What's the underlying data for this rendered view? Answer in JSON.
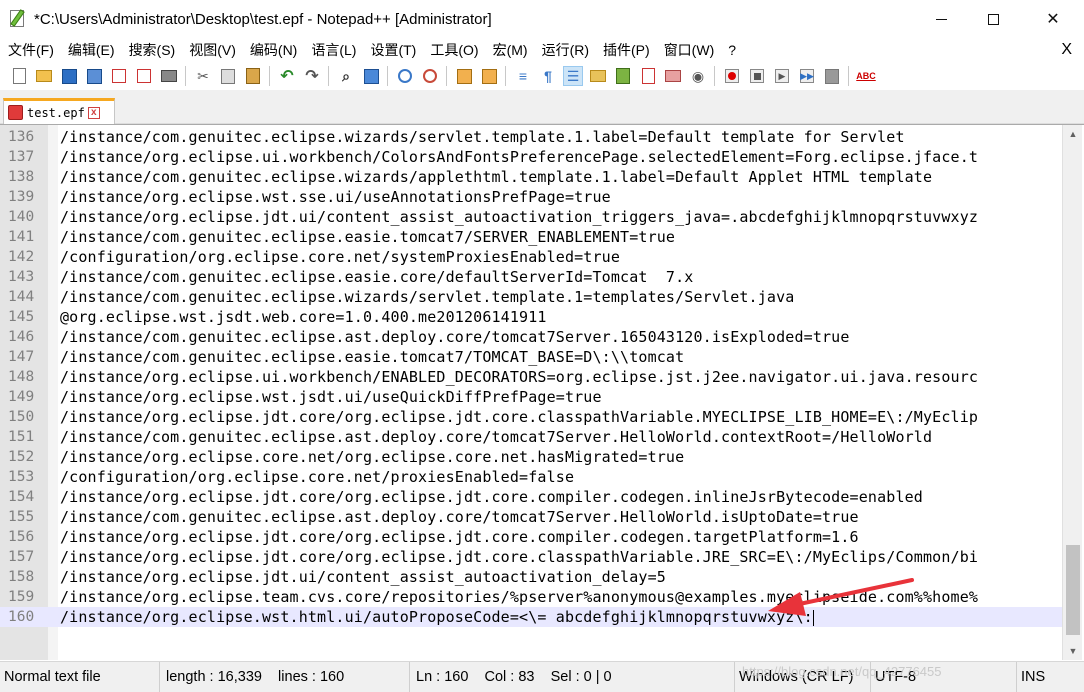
{
  "window": {
    "title": "*C:\\Users\\Administrator\\Desktop\\test.epf - Notepad++ [Administrator]",
    "minimize_label": "",
    "close_glyph": "✕"
  },
  "menu": {
    "items": [
      "文件(F)",
      "编辑(E)",
      "搜索(S)",
      "视图(V)",
      "编码(N)",
      "语言(L)",
      "设置(T)",
      "工具(O)",
      "宏(M)",
      "运行(R)",
      "插件(P)",
      "窗口(W)",
      "?"
    ],
    "close_glyph": "X"
  },
  "toolbar": {
    "icons": [
      "new-file-icon",
      "open-file-icon",
      "save-icon",
      "save-all-icon",
      "close-icon",
      "close-all-icon",
      "print-icon",
      "cut-icon",
      "copy-icon",
      "paste-icon",
      "undo-icon",
      "redo-icon",
      "find-icon",
      "replace-icon",
      "zoom-in-icon",
      "zoom-out-icon",
      "sync-vertical-icon",
      "sync-horizontal-icon",
      "word-wrap-icon",
      "show-all-chars-icon",
      "indent-guide-icon",
      "user-lang-icon",
      "doc-map-icon",
      "function-list-icon",
      "folder-workspace-icon",
      "monitoring-icon",
      "record-macro-icon",
      "stop-record-icon",
      "playback-macro-icon",
      "run-macro-multiple-icon",
      "save-macro-icon",
      "spell-check-icon"
    ],
    "spell_label": "ABC"
  },
  "tabs": [
    {
      "label": "test.epf",
      "close_glyph": "x"
    }
  ],
  "editor": {
    "lines": [
      {
        "num": "136",
        "text": "/instance/com.genuitec.eclipse.wizards/servlet.template.1.label=Default template for Servlet"
      },
      {
        "num": "137",
        "text": "/instance/org.eclipse.ui.workbench/ColorsAndFontsPreferencePage.selectedElement=Forg.eclipse.jface.t"
      },
      {
        "num": "138",
        "text": "/instance/com.genuitec.eclipse.wizards/applethtml.template.1.label=Default Applet HTML template"
      },
      {
        "num": "139",
        "text": "/instance/org.eclipse.wst.sse.ui/useAnnotationsPrefPage=true"
      },
      {
        "num": "140",
        "text": "/instance/org.eclipse.jdt.ui/content_assist_autoactivation_triggers_java=.abcdefghijklmnopqrstuvwxyz"
      },
      {
        "num": "141",
        "text": "/instance/com.genuitec.eclipse.easie.tomcat7/SERVER_ENABLEMENT=true"
      },
      {
        "num": "142",
        "text": "/configuration/org.eclipse.core.net/systemProxiesEnabled=true"
      },
      {
        "num": "143",
        "text": "/instance/com.genuitec.eclipse.easie.core/defaultServerId=Tomcat  7.x"
      },
      {
        "num": "144",
        "text": "/instance/com.genuitec.eclipse.wizards/servlet.template.1=templates/Servlet.java"
      },
      {
        "num": "145",
        "text": "@org.eclipse.wst.jsdt.web.core=1.0.400.me201206141911"
      },
      {
        "num": "146",
        "text": "/instance/com.genuitec.eclipse.ast.deploy.core/tomcat7Server.165043120.isExploded=true"
      },
      {
        "num": "147",
        "text": "/instance/com.genuitec.eclipse.easie.tomcat7/TOMCAT_BASE=D\\:\\\\tomcat"
      },
      {
        "num": "148",
        "text": "/instance/org.eclipse.ui.workbench/ENABLED_DECORATORS=org.eclipse.jst.j2ee.navigator.ui.java.resourc"
      },
      {
        "num": "149",
        "text": "/instance/org.eclipse.wst.jsdt.ui/useQuickDiffPrefPage=true"
      },
      {
        "num": "150",
        "text": "/instance/org.eclipse.jdt.core/org.eclipse.jdt.core.classpathVariable.MYECLIPSE_LIB_HOME=E\\:/MyEclip"
      },
      {
        "num": "151",
        "text": "/instance/com.genuitec.eclipse.ast.deploy.core/tomcat7Server.HelloWorld.contextRoot=/HelloWorld"
      },
      {
        "num": "152",
        "text": "/instance/org.eclipse.core.net/org.eclipse.core.net.hasMigrated=true"
      },
      {
        "num": "153",
        "text": "/configuration/org.eclipse.core.net/proxiesEnabled=false"
      },
      {
        "num": "154",
        "text": "/instance/org.eclipse.jdt.core/org.eclipse.jdt.core.compiler.codegen.inlineJsrBytecode=enabled"
      },
      {
        "num": "155",
        "text": "/instance/com.genuitec.eclipse.ast.deploy.core/tomcat7Server.HelloWorld.isUptoDate=true"
      },
      {
        "num": "156",
        "text": "/instance/org.eclipse.jdt.core/org.eclipse.jdt.core.compiler.codegen.targetPlatform=1.6"
      },
      {
        "num": "157",
        "text": "/instance/org.eclipse.jdt.core/org.eclipse.jdt.core.classpathVariable.JRE_SRC=E\\:/MyEclips/Common/bi"
      },
      {
        "num": "158",
        "text": "/instance/org.eclipse.jdt.ui/content_assist_autoactivation_delay=5"
      },
      {
        "num": "159",
        "text": "/instance/org.eclipse.team.cvs.core/repositories/%pserver%anonymous@examples.myeclipseide.com%%home%"
      },
      {
        "num": "160",
        "text": "/instance/org.eclipse.wst.html.ui/autoProposeCode=<\\= abcdefghijklmnopqrstuvwxyz\\:"
      }
    ],
    "current_line": 24
  },
  "statusbar": {
    "file_type": "Normal text file",
    "length": "length : 16,339    lines : 160",
    "position": "Ln : 160    Col : 83    Sel : 0 | 0",
    "eol": "Windows (CR LF)",
    "encoding": "UTF-8",
    "mode": "INS",
    "watermark": "https://blog.csdn.net/qq_42776455"
  },
  "colors": {
    "tab_accent": "#f6a820",
    "current_line": "#e8e8ff",
    "annotation_arrow": "#e8333a"
  }
}
